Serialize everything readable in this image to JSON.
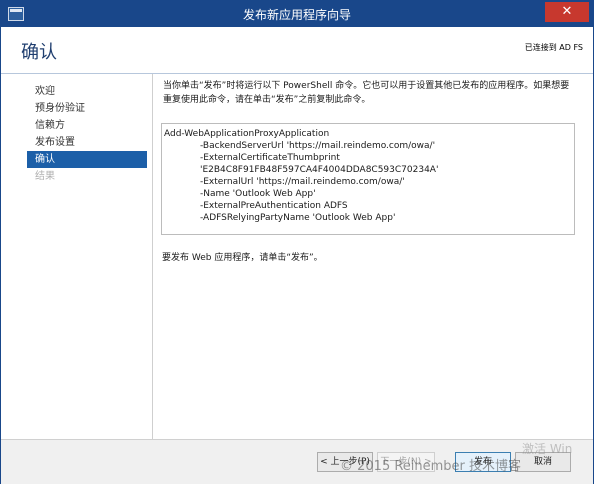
{
  "window": {
    "title": "发布新应用程序向导",
    "close_glyph": "✕"
  },
  "header": {
    "page_title": "确认",
    "status": "已连接到 AD FS"
  },
  "nav": {
    "items": [
      {
        "label": "欢迎",
        "state": "normal"
      },
      {
        "label": "预身份验证",
        "state": "normal"
      },
      {
        "label": "信赖方",
        "state": "normal"
      },
      {
        "label": "发布设置",
        "state": "normal"
      },
      {
        "label": "确认",
        "state": "active"
      },
      {
        "label": "结果",
        "state": "disabled"
      }
    ]
  },
  "main": {
    "description": "当你单击“发布”时将运行以下 PowerShell 命令。它也可以用于设置其他已发布的应用程序。如果想要重复使用此命令，请在单击“发布”之前复制此命令。",
    "command": {
      "first_line": "Add-WebApplicationProxyApplication",
      "params": [
        "-BackendServerUrl 'https://mail.reindemo.com/owa/'",
        "-ExternalCertificateThumbprint 'E2B4C8F91FB48F597CA4F4004DDA8C593C70234A'",
        "-ExternalUrl 'https://mail.reindemo.com/owa/'",
        "-Name 'Outlook Web App'",
        "-ExternalPreAuthentication ADFS",
        "-ADFSRelyingPartyName 'Outlook Web App'"
      ]
    },
    "instruction": "要发布 Web 应用程序，请单击“发布”。"
  },
  "footer": {
    "prev_label": "< 上一步(P)",
    "next_label": "下一步(N) >",
    "publish_label": "发布",
    "cancel_label": "取消"
  },
  "overlay": {
    "watermark": "© 2015 Reinember 技术博客",
    "activation_text": "激活 Win"
  },
  "colors": {
    "titlebar": "#19478a",
    "nav_active": "#1c5fa8",
    "close_button": "#c7382e"
  }
}
